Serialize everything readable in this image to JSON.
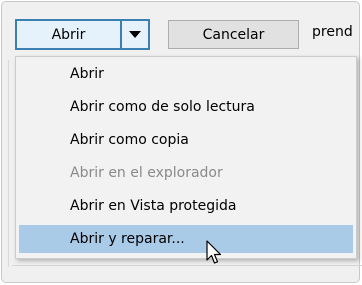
{
  "toolbar": {
    "open_label": "Abrir",
    "cancel_label": "Cancelar",
    "background_text": "prend",
    "open_arrow_icon": "triangle-down"
  },
  "menu": {
    "items": [
      {
        "label": "Abrir",
        "enabled": true,
        "highlighted": false
      },
      {
        "label": "Abrir como de solo lectura",
        "enabled": true,
        "highlighted": false
      },
      {
        "label": "Abrir como copia",
        "enabled": true,
        "highlighted": false
      },
      {
        "label": "Abrir en el explorador",
        "enabled": false,
        "highlighted": false
      },
      {
        "label": "Abrir en Vista protegida",
        "enabled": true,
        "highlighted": false
      },
      {
        "label": "Abrir y reparar...",
        "enabled": true,
        "highlighted": true
      }
    ]
  },
  "colors": {
    "highlight": "#a9cbe8",
    "focus_border": "#3c7fb1",
    "disabled_text": "#8a8a8a"
  }
}
